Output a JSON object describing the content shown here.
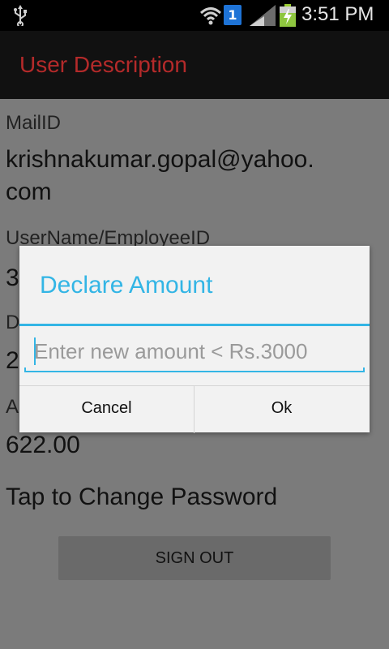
{
  "status_bar": {
    "time": "3:51 PM",
    "sim_badge": "1",
    "icons": [
      "usb-icon",
      "wifi-icon",
      "sim-icon",
      "signal-icon",
      "battery-charging-icon"
    ]
  },
  "action_bar": {
    "title": "User Description",
    "title_color": "#b42a2a"
  },
  "profile": {
    "mail_label": "MailID",
    "mail_value_line1": "krishnakumar.gopal@yahoo.",
    "mail_value_line2": "com",
    "username_label": "UserName/EmployeeID",
    "username_value_partial": "3",
    "field3_label_partial": "D",
    "field3_value_partial": "2",
    "field4_label_partial": "A",
    "field4_value": "622.00",
    "change_password_link": "Tap to Change Password",
    "sign_out_button": "SIGN OUT"
  },
  "dialog": {
    "title": "Declare Amount",
    "input_placeholder": "Enter new amount < Rs.3000",
    "input_value": "",
    "cancel_label": "Cancel",
    "ok_label": "Ok",
    "accent_color": "#33b5e5"
  }
}
